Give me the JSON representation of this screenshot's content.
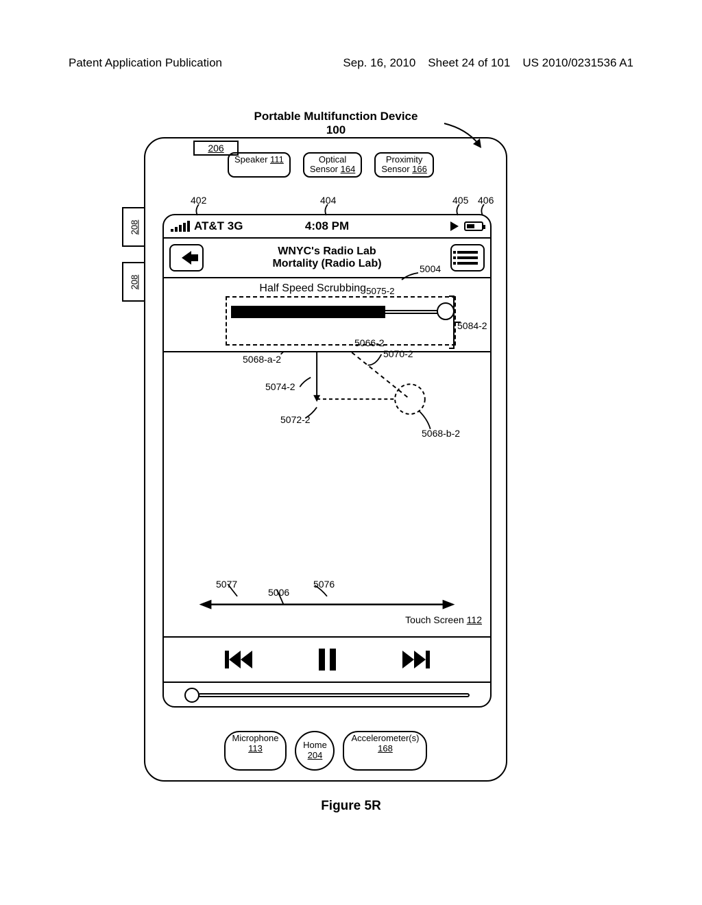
{
  "header": {
    "left": "Patent Application Publication",
    "date": "Sep. 16, 2010",
    "sheet": "Sheet 24 of 101",
    "pubno": "US 2010/0231536 A1"
  },
  "device": {
    "title": "Portable Multifunction Device",
    "ref": "100",
    "box206": "206",
    "tab208": "208",
    "speaker": {
      "label": "Speaker",
      "ref": "111"
    },
    "optical": {
      "label": "Optical",
      "label2": "Sensor",
      "ref": "164"
    },
    "proximity": {
      "label": "Proximity",
      "label2": "Sensor",
      "ref": "166"
    },
    "mic": {
      "label": "Microphone",
      "ref": "113"
    },
    "home": {
      "label": "Home",
      "ref": "204"
    },
    "accel": {
      "label": "Accelerometer(s)",
      "ref": "168"
    },
    "touchscreen": {
      "label": "Touch Screen",
      "ref": "112"
    }
  },
  "status": {
    "carrier": "AT&T 3G",
    "time": "4:08 PM"
  },
  "player": {
    "show": "WNYC's Radio Lab",
    "episode": "Mortality (Radio Lab)",
    "scrub_mode": "Half Speed Scrubbing"
  },
  "callouts": {
    "c402": "402",
    "c404": "404",
    "c405": "405",
    "c406": "406",
    "c5004": "5004",
    "c5066_2": "5066-2",
    "c5068a2": "5068-a-2",
    "c5068b2": "5068-b-2",
    "c5070_2": "5070-2",
    "c5072_2": "5072-2",
    "c5074_2": "5074-2",
    "c5075_2": "5075-2",
    "c5084_2": "5084-2",
    "c5077": "5077",
    "c5076": "5076",
    "c5006": "5006"
  },
  "figure": "Figure 5R"
}
